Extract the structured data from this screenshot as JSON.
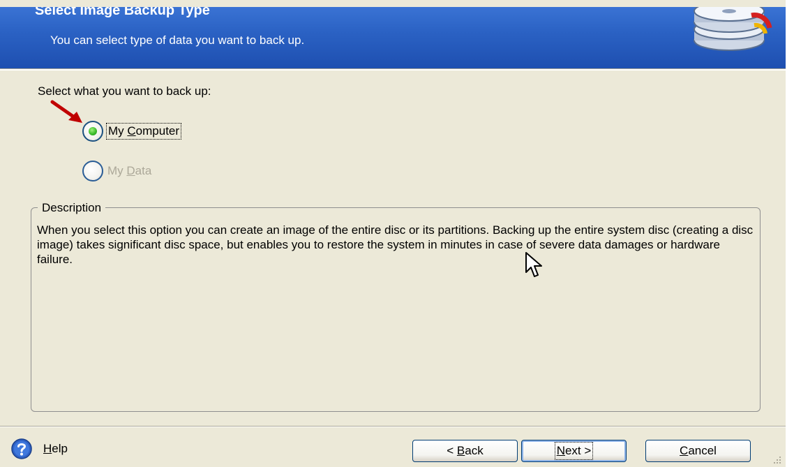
{
  "header": {
    "title": "Select Image Backup Type",
    "subtitle": "You can select type of data you want to back up."
  },
  "prompt": "Select what you want to back up:",
  "options": [
    {
      "label_hotkey": "C",
      "label_pre": "My ",
      "label_post": "omputer",
      "checked": true,
      "enabled": true
    },
    {
      "label_hotkey": "D",
      "label_pre": "My ",
      "label_post": "ata",
      "checked": false,
      "enabled": false
    }
  ],
  "description": {
    "legend": "Description",
    "text": "When you select this option you can create an image of the entire disc or its partitions. Backing up the entire system disc (creating a disc image) takes significant disc space, but enables you to restore the system in minutes in case of severe data damages or hardware failure."
  },
  "footer": {
    "help_hotkey": "H",
    "help_rest": "elp",
    "back_prefix": "< ",
    "back_hotkey": "B",
    "back_rest": "ack",
    "next_hotkey": "N",
    "next_rest": "ext >",
    "cancel_hotkey": "C",
    "cancel_rest": "ancel"
  },
  "colors": {
    "header_blue": "#2b62c4",
    "dialog_bg": "#ece9d8",
    "radio_selected": "#3cbd2c",
    "annotation_arrow": "#c00000"
  },
  "icons": {
    "header": "backup-disks-icon",
    "help": "help-question-icon",
    "annotation": "red-arrow-icon",
    "pointer": "mouse-cursor-icon"
  }
}
